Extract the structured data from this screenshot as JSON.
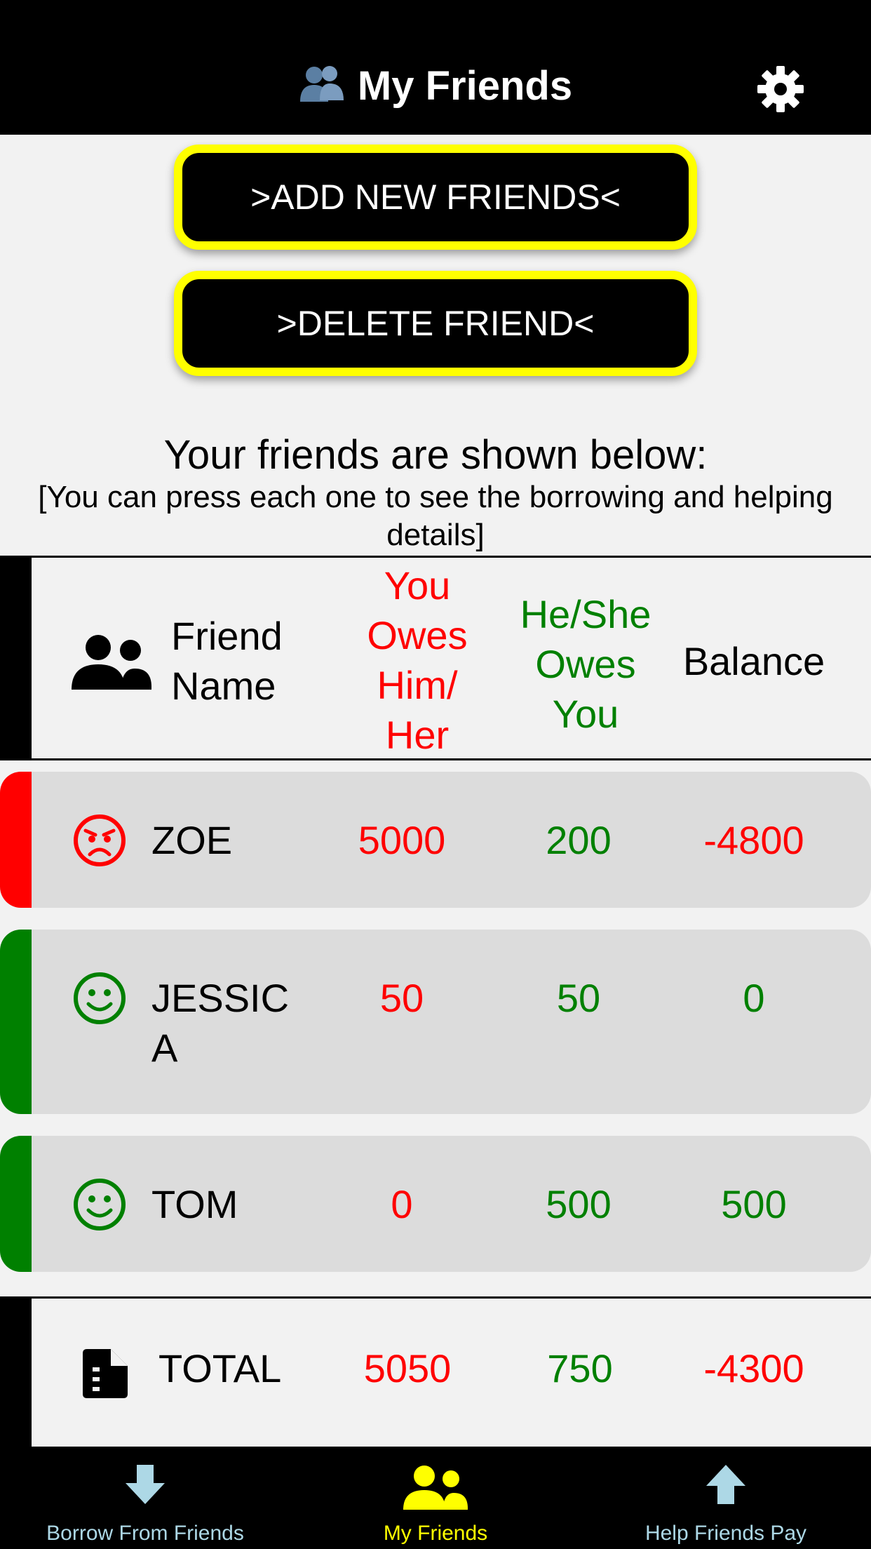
{
  "header": {
    "title": "My Friends",
    "title_icon": "people-icon",
    "settings_icon": "gear-icon"
  },
  "buttons": {
    "add_label": ">ADD NEW FRIENDS<",
    "delete_label": ">DELETE FRIEND<",
    "border_color": "#ffff00"
  },
  "intro": {
    "heading": "Your friends are shown below:",
    "subheading": "[You can press each one to see the borrowing and helping details]"
  },
  "table": {
    "header": {
      "name_line1": "Friend",
      "name_line2": "Name",
      "you_owe": [
        "You",
        "Owes",
        "Him/",
        "Her"
      ],
      "they_owe": [
        "He/She",
        "Owes",
        "You"
      ],
      "balance": "Balance"
    },
    "rows": [
      {
        "name_line1": "ZOE",
        "name_line2": "",
        "you_owe": "5000",
        "they_owe": "200",
        "balance": "-4800",
        "status": "angry",
        "bar_color": "#ff0000"
      },
      {
        "name_line1": "JESSIC",
        "name_line2": "A",
        "you_owe": "50",
        "they_owe": "50",
        "balance": "0",
        "status": "happy",
        "bar_color": "#008000"
      },
      {
        "name_line1": "TOM",
        "name_line2": "",
        "you_owe": "0",
        "they_owe": "500",
        "balance": "500",
        "status": "happy",
        "bar_color": "#008000"
      }
    ],
    "total": {
      "label": "TOTAL",
      "you_owe": "5050",
      "they_owe": "750",
      "balance": "-4300"
    }
  },
  "tabbar": {
    "tabs": [
      {
        "label": "Borrow From Friends",
        "icon": "arrow-down-icon",
        "active": false
      },
      {
        "label": "My Friends",
        "icon": "people-icon",
        "active": true
      },
      {
        "label": "Help Friends Pay",
        "icon": "arrow-up-icon",
        "active": false
      }
    ]
  },
  "colors": {
    "owe_red": "#ff0000",
    "owed_green": "#008000",
    "tab_active": "#ffff00",
    "tab_inactive": "#add8e6"
  }
}
